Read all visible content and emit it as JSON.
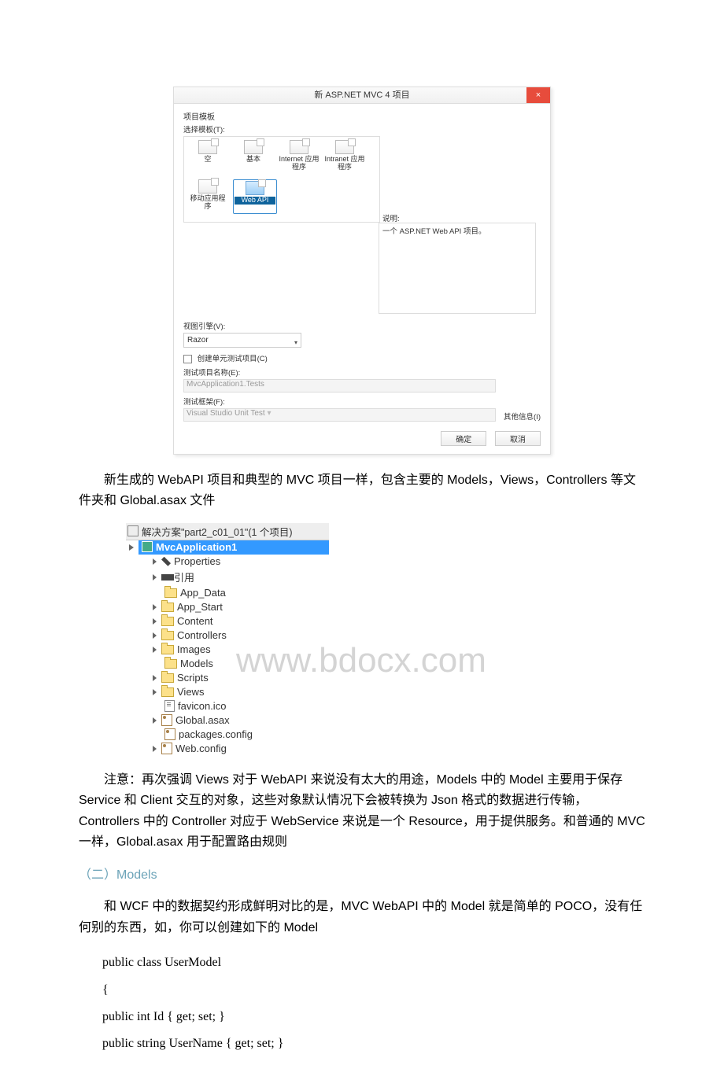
{
  "dialog": {
    "title": "新 ASP.NET MVC 4 项目",
    "project_templates_label": "项目模板",
    "select_template_label": "选择模板(T):",
    "templates": [
      {
        "label": "空"
      },
      {
        "label": "基本"
      },
      {
        "label": "Internet 应用程序"
      },
      {
        "label": "Intranet 应用程序"
      },
      {
        "label": "移动应用程序"
      },
      {
        "label": "Web API"
      }
    ],
    "desc_label": "说明:",
    "desc_text": "一个 ASP.NET Web API 项目。",
    "view_engine_label": "视图引擎(V):",
    "view_engine_value": "Razor",
    "create_unit_test_label": "创建单元测试项目(C)",
    "test_name_label": "测试项目名称(E):",
    "test_name_value": "MvcApplication1.Tests",
    "test_framework_label": "测试框架(F):",
    "test_framework_value": "Visual Studio Unit Test",
    "more_info_label": "其他信息(I)",
    "ok": "确定",
    "cancel": "取消"
  },
  "para1": "新生成的 WebAPI 项目和典型的 MVC 项目一样，包含主要的 Models，Views，Controllers 等文件夹和 Global.asax 文件",
  "solution": {
    "header": "解决方案\"part2_c01_01\"(1 个项目)",
    "project": "MvcApplication1",
    "items": [
      {
        "label": "Properties",
        "icon": "wrench",
        "exp": true
      },
      {
        "label": "引用",
        "icon": "ref",
        "exp": true
      },
      {
        "label": "App_Data",
        "icon": "folder",
        "exp": false
      },
      {
        "label": "App_Start",
        "icon": "folder",
        "exp": true
      },
      {
        "label": "Content",
        "icon": "folder",
        "exp": true
      },
      {
        "label": "Controllers",
        "icon": "folder",
        "exp": true
      },
      {
        "label": "Images",
        "icon": "folder",
        "exp": true
      },
      {
        "label": "Models",
        "icon": "folder",
        "exp": false
      },
      {
        "label": "Scripts",
        "icon": "folder",
        "exp": true
      },
      {
        "label": "Views",
        "icon": "folder",
        "exp": true
      },
      {
        "label": "favicon.ico",
        "icon": "file",
        "exp": false
      },
      {
        "label": "Global.asax",
        "icon": "xml",
        "exp": true
      },
      {
        "label": "packages.config",
        "icon": "xml",
        "exp": false
      },
      {
        "label": "Web.config",
        "icon": "xml",
        "exp": true
      }
    ]
  },
  "watermark": "www.bdocx.com",
  "para2": "注意：再次强调 Views 对于 WebAPI 来说没有太大的用途，Models 中的 Model 主要用于保存 Service 和 Client 交互的对象，这些对象默认情况下会被转换为 Json 格式的数据进行传输，Controllers 中的 Controller 对应于 WebService 来说是一个 Resource，用于提供服务。和普通的 MVC 一样，Global.asax 用于配置路由规则",
  "section2": "（二）Models",
  "para3": "和 WCF 中的数据契约形成鲜明对比的是，MVC WebAPI 中的 Model 就是简单的 POCO，没有任何别的东西，如，你可以创建如下的 Model",
  "code": {
    "l1": "public class UserModel",
    "l2": "{",
    "l3": "public int Id { get; set; }",
    "l4": "public string UserName { get; set; }"
  }
}
